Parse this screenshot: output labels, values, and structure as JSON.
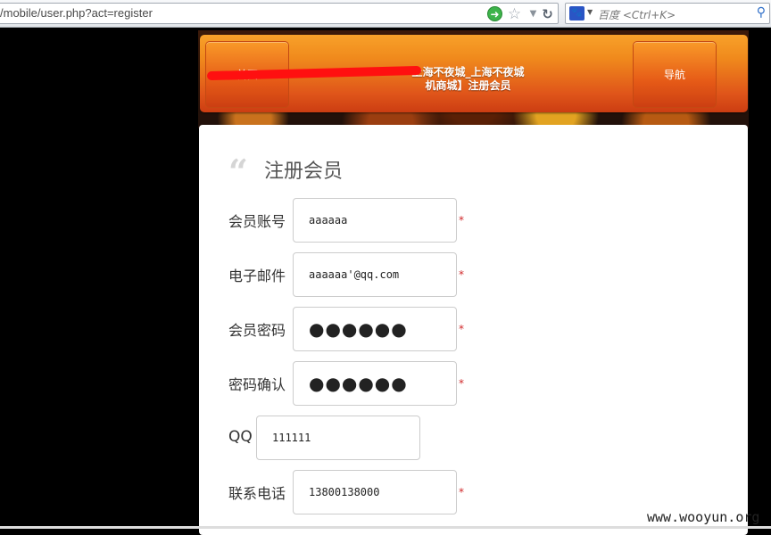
{
  "browser": {
    "url": "/mobile/user.php?act=register",
    "search_placeholder": "百度 <Ctrl+K>",
    "icons": {
      "go": "go-arrow-icon",
      "bookmark": "star-icon",
      "history": "dropdown-arrow-icon",
      "reload": "reload-icon",
      "search_engine": "baidu-icon",
      "search": "magnifier-icon"
    }
  },
  "header": {
    "home_label": "首页",
    "nav_label": "导航",
    "title_line1": "上海不夜城_上海不夜城",
    "title_line2": "机商城】注册会员"
  },
  "form": {
    "title": "注册会员",
    "fields": [
      {
        "label": "会员账号",
        "value": "aaaaaa",
        "required": true
      },
      {
        "label": "电子邮件",
        "value": "aaaaaa'@qq.com",
        "required": true
      },
      {
        "label": "会员密码",
        "value": "●●●●●●",
        "required": true
      },
      {
        "label": "密码确认",
        "value": "●●●●●●",
        "required": true
      },
      {
        "label": "QQ",
        "value": "111111",
        "required": false
      },
      {
        "label": "联系电话",
        "value": "13800138000",
        "required": true
      }
    ],
    "required_mark": "*"
  },
  "watermark": "www.wooyun.org",
  "colors": {
    "nav_orange": "#f08a1c",
    "nav_red": "#cc3d12",
    "required_red": "#d0282a",
    "redaction": "#ff1010"
  }
}
